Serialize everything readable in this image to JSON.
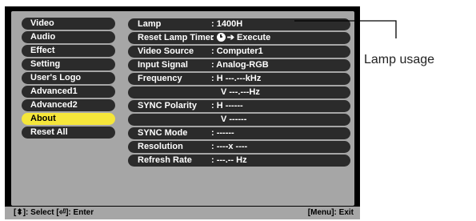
{
  "menu": {
    "items": [
      {
        "label": "Video",
        "active": false
      },
      {
        "label": "Audio",
        "active": false
      },
      {
        "label": "Effect",
        "active": false
      },
      {
        "label": "Setting",
        "active": false
      },
      {
        "label": "User's Logo",
        "active": false
      },
      {
        "label": "Advanced1",
        "active": false
      },
      {
        "label": "Advanced2",
        "active": false
      },
      {
        "label": "About",
        "active": true
      },
      {
        "label": "Reset All",
        "active": false
      }
    ],
    "highlight_color": "#f5e63a"
  },
  "about": {
    "lamp": {
      "label": "Lamp",
      "value": ": 1400H"
    },
    "reset_lamp_timer": {
      "label": "Reset Lamp Timer",
      "colon": ":",
      "arrow": "➔",
      "action": "Execute",
      "icon": "enter-icon"
    },
    "video_source": {
      "label": "Video Source",
      "value": ": Computer1"
    },
    "input_signal": {
      "label": "Input Signal",
      "value": ": Analog-RGB"
    },
    "frequency": {
      "label": "Frequency",
      "value_h": ": H ---.---kHz",
      "value_v": "V ---.---Hz"
    },
    "sync_polarity": {
      "label": "SYNC Polarity",
      "value_h": ": H ------",
      "value_v": "V ------"
    },
    "sync_mode": {
      "label": "SYNC Mode",
      "value": ": ------"
    },
    "resolution": {
      "label": "Resolution",
      "value": ": ----x  ----"
    },
    "refresh_rate": {
      "label": "Refresh Rate",
      "value": ": ---.-- Hz"
    }
  },
  "footer": {
    "left": "[⬍]: Select  [⏎]: Enter",
    "right": "[Menu]: Exit"
  },
  "annotation": {
    "text": "Lamp usage"
  }
}
